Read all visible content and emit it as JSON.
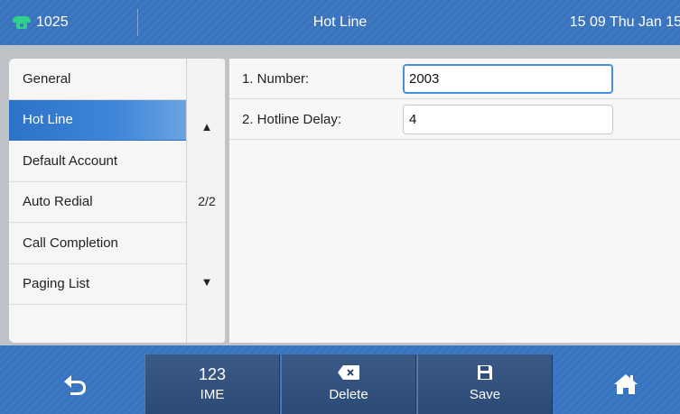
{
  "status_bar": {
    "line_label": "1025",
    "title": "Hot Line",
    "clock": "15 09 Thu Jan 15"
  },
  "menu": {
    "items": [
      {
        "label": "General"
      },
      {
        "label": "Hot Line"
      },
      {
        "label": "Default Account"
      },
      {
        "label": "Auto Redial"
      },
      {
        "label": "Call Completion"
      },
      {
        "label": "Paging List"
      }
    ],
    "active_index": 1
  },
  "pager": {
    "page": "2/2",
    "up_glyph": "▲",
    "down_glyph": "▼"
  },
  "settings": {
    "rows": [
      {
        "label": "1. Number:",
        "value": "2003"
      },
      {
        "label": "2. Hotline Delay:",
        "value": "4"
      }
    ]
  },
  "softkeys": {
    "ime_top": "123",
    "ime_label": "IME",
    "delete_label": "Delete",
    "save_label": "Save"
  },
  "colors": {
    "bar_blue": "#3b76bf",
    "active_item": "#2c73c9",
    "phone_icon": "#2fd08a",
    "focus_border": "#4a8fdc"
  },
  "icons": {
    "line": "phone-icon",
    "back": "back-arrow-icon",
    "delete": "backspace-icon",
    "save": "floppy-disk-icon",
    "home": "home-icon"
  }
}
